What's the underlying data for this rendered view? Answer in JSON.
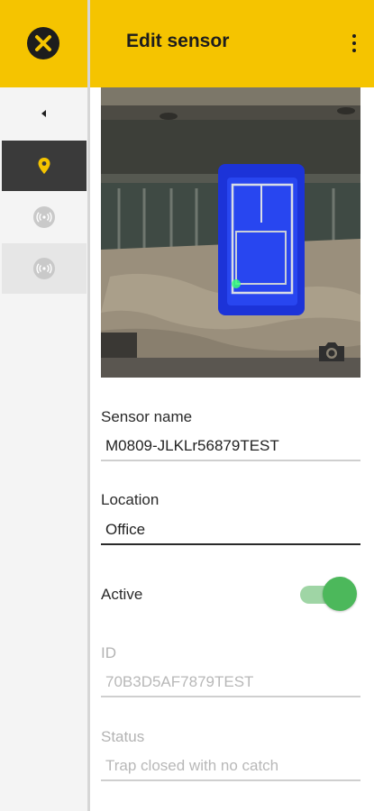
{
  "app": {
    "title": "Edit sensor",
    "accent_color": "#f5c400"
  },
  "rail": {
    "items": [
      {
        "name": "location",
        "icon": "map-pin-icon",
        "active": true
      },
      {
        "name": "sensor-1",
        "icon": "sensor-signal-icon",
        "active": false
      },
      {
        "name": "sensor-2",
        "icon": "sensor-signal-icon",
        "active": false
      }
    ]
  },
  "form": {
    "sensor_name": {
      "label": "Sensor name",
      "value": "M0809-JLKLr56879TEST"
    },
    "location": {
      "label": "Location",
      "value": "Office"
    },
    "active": {
      "label": "Active",
      "on": true,
      "color": "#4cb85b"
    },
    "id": {
      "label": "ID",
      "value": "70B3D5AF7879TEST"
    },
    "status": {
      "label": "Status",
      "value": "Trap closed with no catch"
    }
  }
}
